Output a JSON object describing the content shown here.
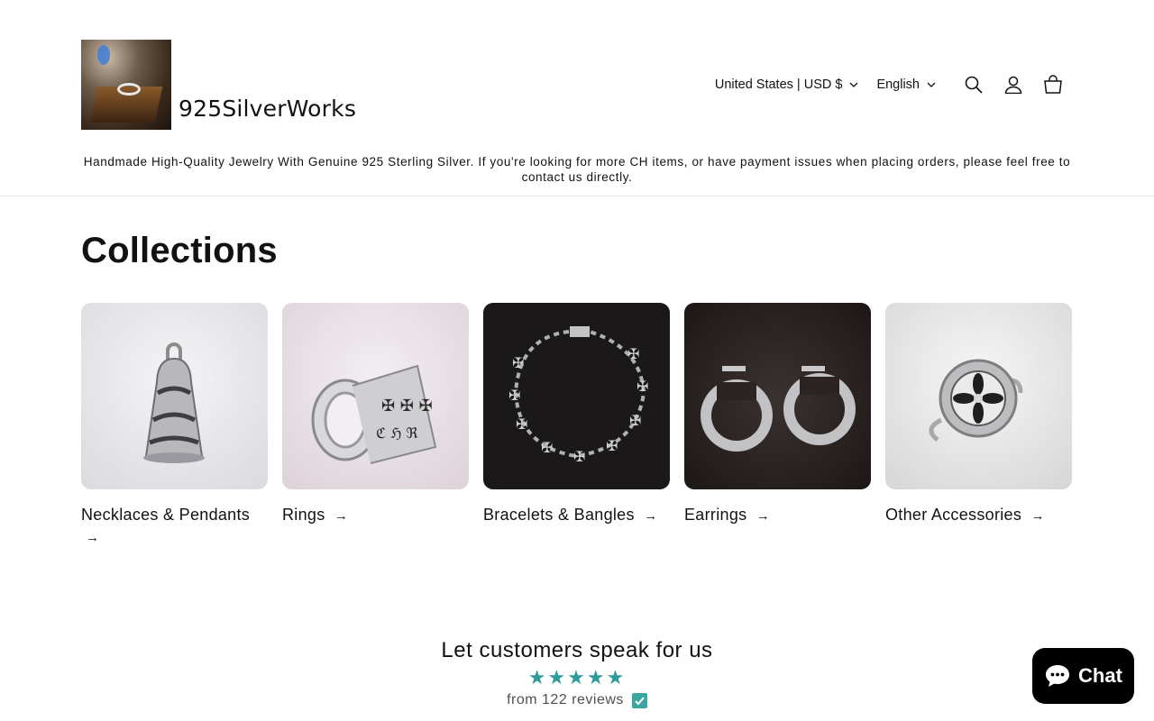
{
  "header": {
    "logo_text": "925SilverWorks",
    "country_selector": "United States | USD $",
    "language_selector": "English",
    "icons": [
      "search-icon",
      "account-icon",
      "cart-icon"
    ]
  },
  "announcement": "Handmade High-Quality Jewelry With Genuine 925 Sterling Silver. If you're looking for more CH items, or have payment issues when placing orders, please feel free to contact us directly.",
  "collections": {
    "title": "Collections",
    "items": [
      {
        "label": "Necklaces & Pendants",
        "arrow": "→"
      },
      {
        "label": "Rings",
        "arrow": "→"
      },
      {
        "label": "Bracelets & Bangles",
        "arrow": "→"
      },
      {
        "label": "Earrings",
        "arrow": "→"
      },
      {
        "label": "Other Accessories",
        "arrow": "→"
      }
    ]
  },
  "reviews": {
    "title": "Let customers speak for us",
    "stars": "★★★★★",
    "rating_stars": 5,
    "summary": "from 122 reviews"
  },
  "chat": {
    "label": "Chat"
  },
  "colors": {
    "star": "#2f9c9c",
    "chat_bg": "#000000",
    "text": "#121212"
  }
}
